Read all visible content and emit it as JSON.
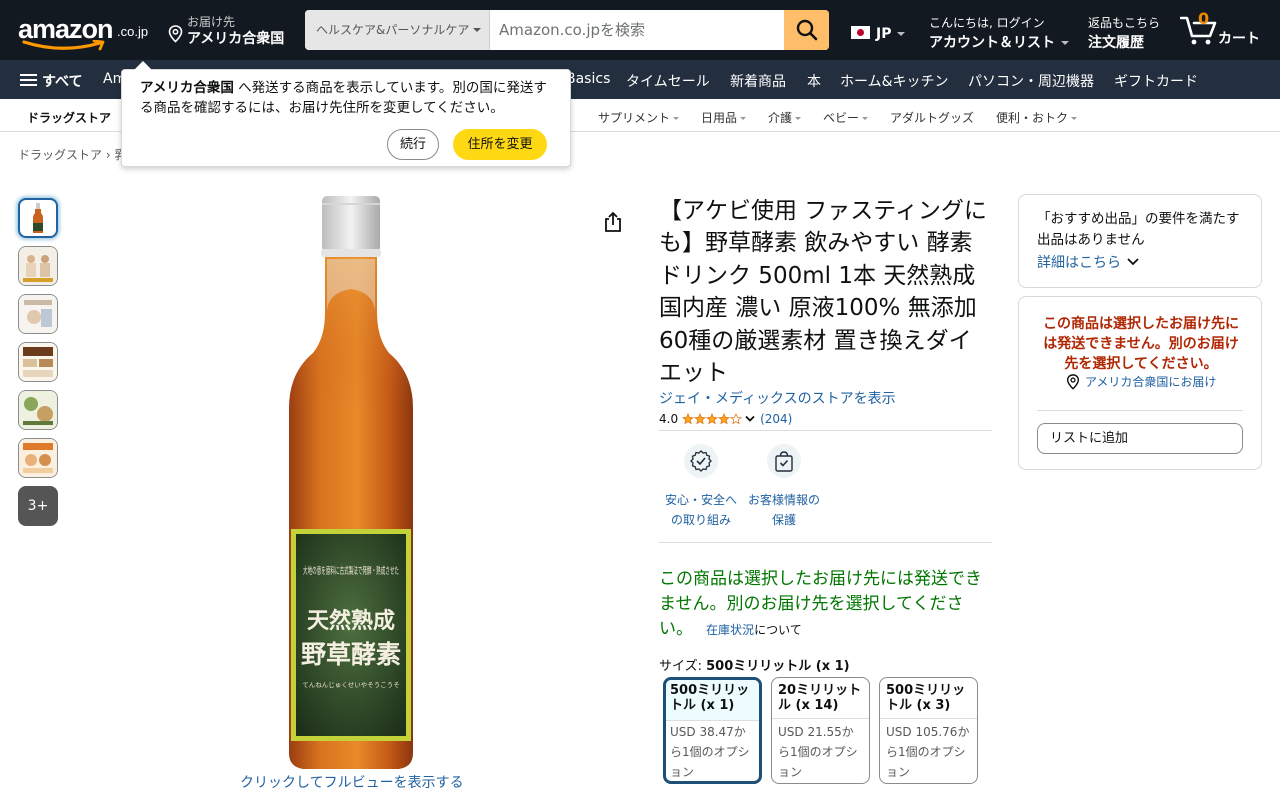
{
  "header": {
    "logo_word": "amazon",
    "logo_tld": ".co.jp",
    "deliver_line1": "お届け先",
    "deliver_line2": "アメリカ合衆国",
    "search_category": "ヘルスケア&パーソナルケア",
    "search_placeholder": "Amazon.co.jpを検索",
    "language": "JP",
    "account_line1": "こんにちは, ログイン",
    "account_line2": "アカウント＆リスト",
    "orders_line1": "返品もこちら",
    "orders_line2": "注文履歴",
    "cart_count": "0",
    "cart_label": "カート",
    "accent_color": "#febd69"
  },
  "main_nav": {
    "all_label": "すべて",
    "items": [
      "Am",
      "Basics",
      "タイムセール",
      "新着商品",
      "本",
      "ホーム&キッチン",
      "パソコン・周辺機器",
      "ギフトカード"
    ]
  },
  "sub_nav": {
    "items": [
      "ドラッグストア",
      "サプリメント",
      "日用品",
      "介護",
      "ベビー",
      "アダルトグッズ",
      "便利・おトク"
    ]
  },
  "breadcrumb": "ドラッグストア › 乳",
  "popover": {
    "country": "アメリカ合衆国",
    "message": " へ発送する商品を表示しています。別の国に発送する商品を確認するには、お届け先住所を変更してください。",
    "continue_label": "続行",
    "change_label": "住所を変更"
  },
  "gallery": {
    "more_label": "3+",
    "zoom_label": "クリックしてフルビューを表示する",
    "label_top": "大地の恵を原料に古式製法で発酵・熟成させた",
    "label_main1": "天然熟成",
    "label_main2": "野草酵素",
    "label_sub": "てんねんじゅくせいやそうこうそ"
  },
  "product": {
    "title": "【アケビ使用 ファスティングにも】野草酵素 飲みやすい 酵素ドリンク 500ml 1本 天然熟成 国内産 濃い 原液100% 無添加 60種の厳選素材 置き換えダイエット",
    "store_link": "ジェイ・メディックスのストアを表示",
    "rating_value": "4.0",
    "rating_fraction": 0.8,
    "rating_count": "(204)",
    "trust_1": "安心・安全への取り組み",
    "trust_2": "お客様情報の保護",
    "unavailable": "この商品は選択したお届け先には発送できません。別のお届け先を選択してください。",
    "stock_link": "在庫状況",
    "stock_suffix": "について",
    "size_label": "サイズ: ",
    "size_selected": "500ミリリットル (x 1)",
    "size_options": [
      {
        "name": "500ミリリットル (x 1)",
        "price": "USD 38.47から1個のオプション"
      },
      {
        "name": "20ミリリットル (x 14)",
        "price": "USD 21.55から1個のオプション"
      },
      {
        "name": "500ミリリットル (x 3)",
        "price": "USD 105.76から1個のオプション"
      }
    ]
  },
  "buybox": {
    "featured_text": "「おすすめ出品」の要件を満たす出品はありません",
    "details_link": "詳細はこちら",
    "warning": "この商品は選択したお届け先には発送できません。別のお届け先を選択してください。",
    "address_link": "アメリカ合衆国にお届け",
    "add_to_list": "リストに追加",
    "warning_color": "#b12704",
    "link_color": "#2162a1"
  }
}
